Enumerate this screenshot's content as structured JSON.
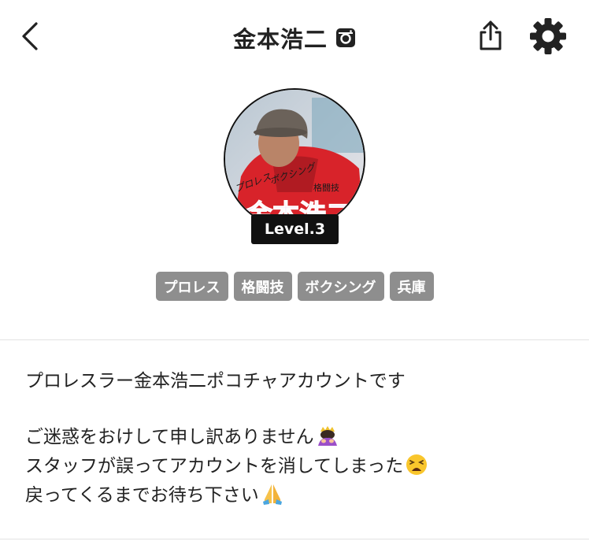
{
  "header": {
    "title": "金本浩二"
  },
  "profile": {
    "level": "Level.3",
    "avatar_text": {
      "line1": "プロレス",
      "line2": "ボクシング",
      "line3": "格闘技",
      "name": "金本浩二"
    }
  },
  "tags": [
    {
      "label": "プロレス"
    },
    {
      "label": "格闘技"
    },
    {
      "label": "ボクシング"
    },
    {
      "label": "兵庫"
    }
  ],
  "bio": {
    "line1": "プロレスラー金本浩二ポコチャアカウントです",
    "line2": "ご迷惑をおけして申し訳ありません",
    "line3": "スタッフが誤ってアカウントを消してしまった",
    "line4": "戻ってくるまでお待ち下さい"
  },
  "icons": {
    "back": "chevron-left-icon",
    "instagram": "instagram-icon",
    "share": "share-icon",
    "settings": "gear-icon",
    "emoji1": "person-bowing-emoji",
    "emoji2": "tired-face-emoji",
    "emoji3": "folded-hands-emoji"
  },
  "colors": {
    "tag_bg": "#8e8e8e",
    "badge_bg": "#111111",
    "text": "#222222",
    "divider": "#e3e3e3"
  }
}
